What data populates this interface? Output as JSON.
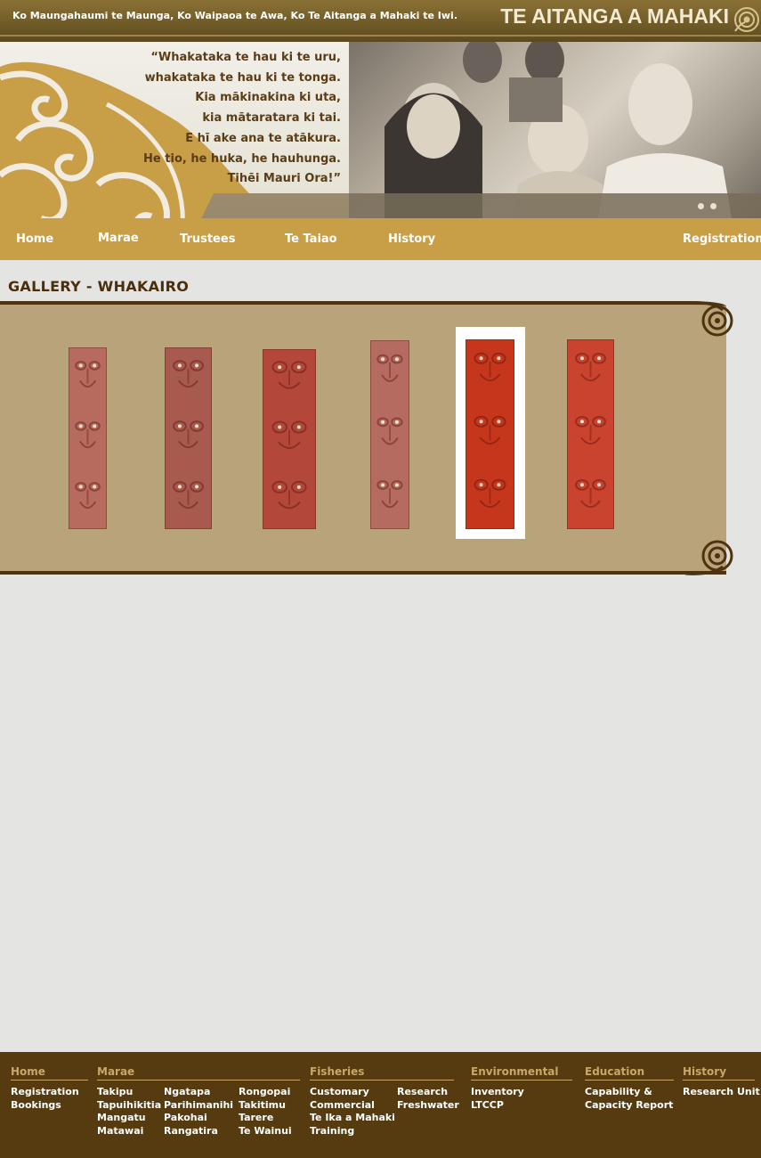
{
  "header": {
    "tagline": "Ko Maungahaumi te Maunga, Ko Waipaoa te Awa, Ko Te Aitanga a Mahaki te Iwi.",
    "brand": "TE AITANGA A MAHAKI",
    "brand_icon": "koru-fern-icon"
  },
  "banner": {
    "proverb_lines": [
      "“Whakataka te hau ki te uru,",
      "whakataka te hau ki te tonga.",
      "Kia mākinakina ki uta,",
      "kia mātaratara ki tai.",
      "E hī ake ana te atākura.",
      "He tio, he huka, he hauhunga.",
      "Tihēi Mauri Ora!”"
    ],
    "photo": "elders-group-photo"
  },
  "nav": {
    "items": [
      "Home",
      "Marae",
      "Trustees",
      "Te Taiao",
      "History"
    ],
    "registration": "Registration"
  },
  "page": {
    "title": "GALLERY - WHAKAIRO"
  },
  "gallery": {
    "selected_index": 4,
    "thumbnails": [
      {
        "label": "whakairo-carving-1",
        "color": "#b76a5e"
      },
      {
        "label": "whakairo-carving-2",
        "color": "#a85a4f"
      },
      {
        "label": "whakairo-carving-3",
        "color": "#b2473a"
      },
      {
        "label": "whakairo-carving-4",
        "color": "#b56b60"
      },
      {
        "label": "whakairo-carving-5",
        "color": "#c5361c"
      },
      {
        "label": "whakairo-carving-6",
        "color": "#c9432e"
      }
    ]
  },
  "footer": {
    "columns": [
      {
        "heading": "Home",
        "groups": [
          [
            "Registration",
            "Bookings"
          ]
        ]
      },
      {
        "heading": "Marae",
        "groups": [
          [
            "Takipu",
            "Tapuihikitia",
            "Mangatu",
            "Matawai"
          ],
          [
            "Ngatapa",
            "Parihimanihi",
            "Pakohai",
            "Rangatira"
          ],
          [
            "Rongopai",
            "Takitimu",
            "Tarere",
            "Te Wainui"
          ]
        ]
      },
      {
        "heading": "Fisheries",
        "groups": [
          [
            "Customary",
            "Commercial",
            "Te Ika a Mahaki",
            "Training"
          ],
          [
            "Research",
            "Freshwater"
          ]
        ]
      },
      {
        "heading": "Environmental",
        "groups": [
          [
            "Inventory",
            "LTCCP"
          ]
        ]
      },
      {
        "heading": "Education",
        "groups": [
          [
            "Capability &",
            "Capacity Report"
          ]
        ]
      },
      {
        "heading": "History",
        "groups": [
          [
            "Research Unit"
          ]
        ]
      }
    ]
  },
  "colors": {
    "nav": "#c89e47",
    "gallery_bg": "#b8a37b",
    "footer_bg": "#553b0f",
    "footer_heading": "#c9a766",
    "title": "#4b2e0b"
  }
}
